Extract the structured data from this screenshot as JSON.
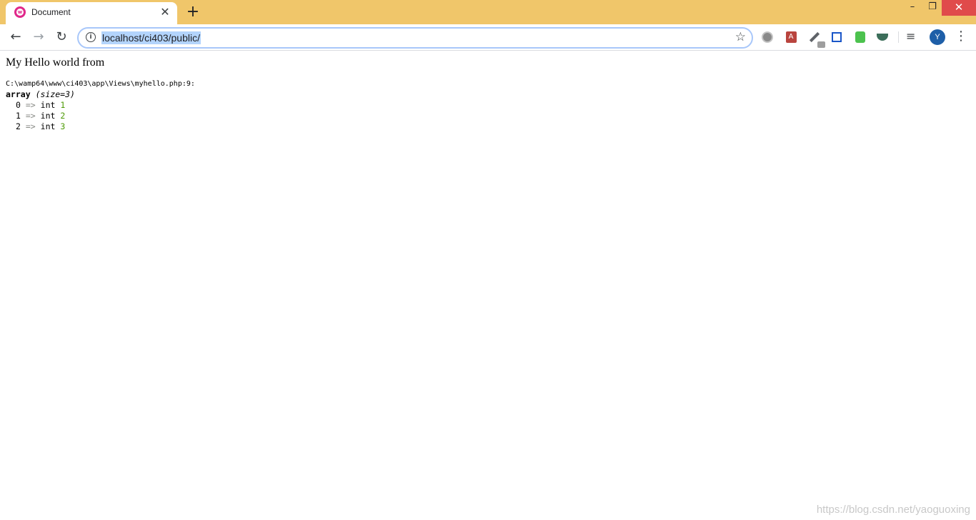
{
  "tab": {
    "title": "Document",
    "favicon_letter": "w",
    "close_glyph": "✕",
    "new_tab_glyph": "+"
  },
  "window_controls": {
    "minimize": "–",
    "restore": "❐",
    "close": "✕"
  },
  "toolbar": {
    "back_glyph": "←",
    "forward_glyph": "→",
    "reload_glyph": "↻",
    "url": "localhost/ci403/public/",
    "info_glyph": "i",
    "star_glyph": "☆",
    "media_glyph": "≡",
    "avatar_letter": "Y",
    "menu_glyph": "⋮",
    "extensions": [
      "screen-capture-icon",
      "pdf-icon",
      "eyedropper-icon",
      "crop-icon",
      "green-extension-icon",
      "bird-extension-icon"
    ]
  },
  "page": {
    "heading": "My Hello world from",
    "dump": {
      "path": "C:\\wamp64\\www\\ci403\\app\\Views\\myhello.php:9:",
      "type_keyword": "array",
      "size_text": "(size=3)",
      "rows": [
        {
          "key": "0",
          "arrow": "=>",
          "type": "int",
          "value": "1"
        },
        {
          "key": "1",
          "arrow": "=>",
          "type": "int",
          "value": "2"
        },
        {
          "key": "2",
          "arrow": "=>",
          "type": "int",
          "value": "3"
        }
      ]
    }
  },
  "watermark": "https://blog.csdn.net/yaoguoxing",
  "colors": {
    "titlebar": "#f0c66a",
    "url_highlight": "#b3d4fc",
    "int_value": "#4e9a06",
    "arrow": "#888a85",
    "avatar": "#1e5fa8"
  }
}
